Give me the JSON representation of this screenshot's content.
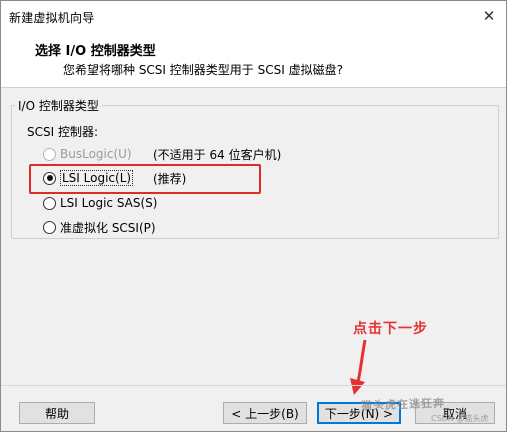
{
  "window": {
    "title": "新建虚拟机向导",
    "close_glyph": "✕"
  },
  "header": {
    "title": "选择 I/O 控制器类型",
    "subtitle": "您希望将哪种 SCSI 控制器类型用于 SCSI 虚拟磁盘?"
  },
  "group": {
    "title": "I/O 控制器类型",
    "scsi_label": "SCSI 控制器:",
    "options": [
      {
        "label": "BusLogic(U)",
        "note": "(不适用于 64 位客户机)",
        "enabled": false,
        "selected": false
      },
      {
        "label": "LSI Logic(L)",
        "note": "(推荐)",
        "enabled": true,
        "selected": true
      },
      {
        "label": "LSI Logic SAS(S)",
        "note": "",
        "enabled": true,
        "selected": false
      },
      {
        "label": "准虚拟化 SCSI(P)",
        "note": "",
        "enabled": true,
        "selected": false
      }
    ]
  },
  "annotation": {
    "text": "点击下一步",
    "color": "#e53131"
  },
  "buttons": {
    "help": "帮助",
    "back": "< 上一步(B)",
    "next": "下一步(N) >",
    "cancel": "取消"
  },
  "watermark": {
    "text": "猫头虎在逃狂奔",
    "credit": "CSDN @猫头虎"
  },
  "colors": {
    "highlight": "#e02a2a",
    "default_button_border": "#0078d7"
  }
}
